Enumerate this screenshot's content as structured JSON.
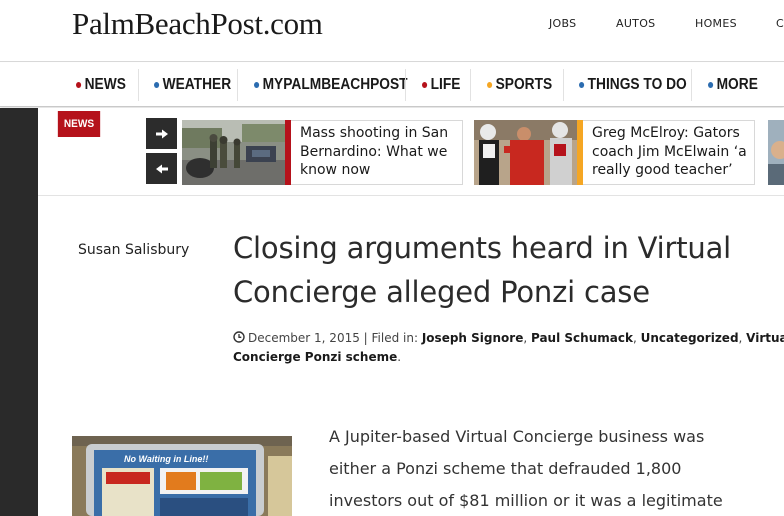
{
  "header": {
    "logo": "PalmBeachPost.com",
    "links": [
      "JOBS",
      "AUTOS",
      "HOMES",
      "C"
    ]
  },
  "nav": {
    "items": [
      {
        "label": "NEWS",
        "dot": "#b5121b"
      },
      {
        "label": "WEATHER",
        "dot": "#2b6cb0"
      },
      {
        "label": "MYPALMBEACHPOST",
        "dot": "#2b6cb0"
      },
      {
        "label": "LIFE",
        "dot": "#b5121b"
      },
      {
        "label": "SPORTS",
        "dot": "#f5a623"
      },
      {
        "label": "THINGS TO DO",
        "dot": "#2b6cb0"
      },
      {
        "label": "MORE",
        "dot": "#2b6cb0"
      }
    ]
  },
  "news_strip": {
    "tag": "NEWS",
    "next_icon": "arrow-right-icon",
    "prev_icon": "arrow-left-icon",
    "stories": [
      {
        "title": "Mass shooting in San Bernardino: What we know now",
        "accent": "#b5121b"
      },
      {
        "title": "Greg McElroy: Gators coach Jim McElwain ‘a really good teacher’",
        "accent": "#f5a623"
      }
    ]
  },
  "article": {
    "author": "Susan Salisbury",
    "headline": "Closing arguments heard in Virtual Concierge alleged Ponzi case",
    "date": "December 1, 2015",
    "filed_label": "Filed in:",
    "categories": [
      "Joseph Signore",
      "Paul Schumack",
      "Uncategorized",
      "Virtual Concierge Ponzi scheme"
    ],
    "body_lines": [
      "A Jupiter-based Virtual Concierge business was",
      "either a Ponzi scheme that defrauded 1,800",
      "investors out of $81 million or it was a legitimate"
    ],
    "image_caption": "No Waiting in Line!!"
  }
}
